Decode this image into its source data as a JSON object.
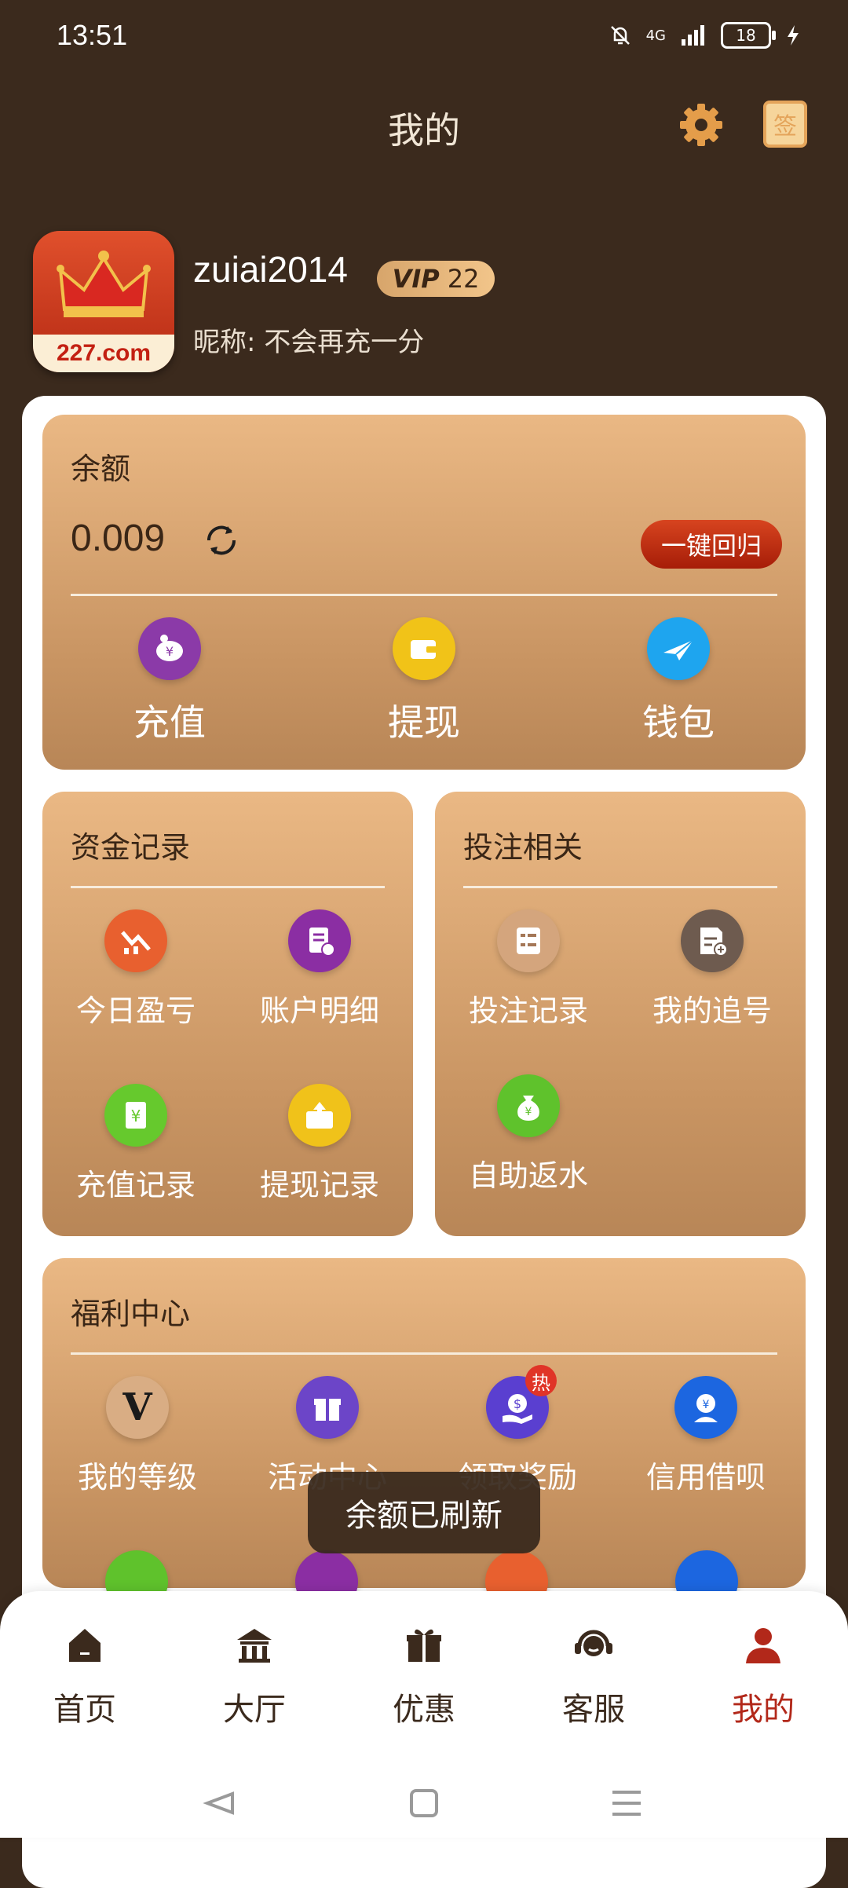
{
  "status_bar": {
    "time": "13:51",
    "network": "4G",
    "battery": "18"
  },
  "header": {
    "title": "我的",
    "settings_icon": "gear-icon",
    "sign_label": "签"
  },
  "profile": {
    "avatar_brand": "227.com",
    "username": "zuiai2014",
    "vip_label": "VIP",
    "vip_level": "22",
    "nickname": "昵称: 不会再充一分"
  },
  "balance": {
    "label": "余额",
    "amount": "0.009",
    "recover_button": "一键回归",
    "actions": [
      {
        "label": "充值",
        "icon": "piggy-bank-icon",
        "color": "#8b3aa8"
      },
      {
        "label": "提现",
        "icon": "wallet-icon",
        "color": "#f1c318"
      },
      {
        "label": "钱包",
        "icon": "paper-plane-icon",
        "color": "#1ea5ef"
      }
    ]
  },
  "funds": {
    "title": "资金记录",
    "items": [
      {
        "label": "今日盈亏",
        "icon": "chart-down-icon",
        "color": "#e8602f"
      },
      {
        "label": "账户明细",
        "icon": "document-icon",
        "color": "#8b2ea3"
      },
      {
        "label": "充值记录",
        "icon": "yen-card-icon",
        "color": "#66c92d"
      },
      {
        "label": "提现记录",
        "icon": "upload-box-icon",
        "color": "#f0c21a"
      }
    ]
  },
  "betting": {
    "title": "投注相关",
    "items": [
      {
        "label": "投注记录",
        "icon": "list-icon",
        "color": "#c9936a"
      },
      {
        "label": "我的追号",
        "icon": "add-document-icon",
        "color": "#6e5b4f"
      },
      {
        "label": "自助返水",
        "icon": "money-bag-icon",
        "color": "#5fc22c"
      }
    ]
  },
  "welfare": {
    "title": "福利中心",
    "items": [
      {
        "label": "我的等级",
        "icon": "level-v-icon",
        "color": "#c49066"
      },
      {
        "label": "活动中心",
        "icon": "gift-icon",
        "color": "#6c45c8"
      },
      {
        "label": "领取奖励",
        "icon": "dollar-hand-icon",
        "color": "#5a3fd0",
        "badge": "热"
      },
      {
        "label": "信用借呗",
        "icon": "yen-user-icon",
        "color": "#1c66e0"
      }
    ]
  },
  "toast": "余额已刷新",
  "nav": {
    "items": [
      {
        "label": "首页",
        "icon": "home-icon"
      },
      {
        "label": "大厅",
        "icon": "hall-icon"
      },
      {
        "label": "优惠",
        "icon": "gift-icon"
      },
      {
        "label": "客服",
        "icon": "headset-icon"
      },
      {
        "label": "我的",
        "icon": "user-icon",
        "active": true
      }
    ]
  },
  "colors": {
    "background": "#3b2a1d",
    "accent": "#b2281a",
    "card": "#d5a16f"
  }
}
